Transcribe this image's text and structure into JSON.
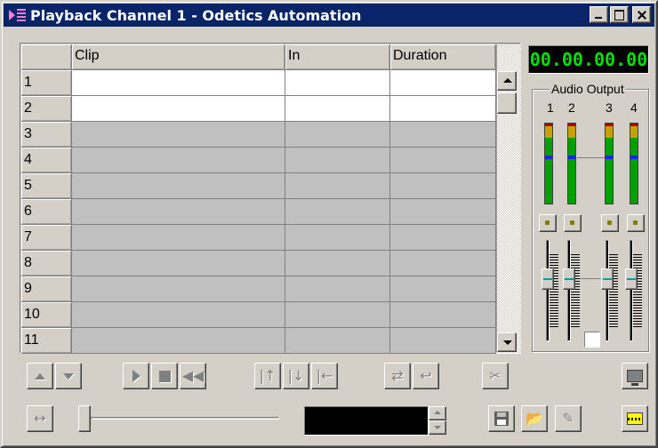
{
  "window": {
    "title": "Playback Channel 1 - Odetics Automation",
    "buttons": {
      "minimize": "minimize",
      "maximize": "maximize",
      "close": "close"
    }
  },
  "grid": {
    "columns": [
      "",
      "Clip",
      "In",
      "Duration"
    ],
    "rows": [
      {
        "num": "1",
        "clip": "",
        "in": "",
        "duration": "",
        "state": "white"
      },
      {
        "num": "2",
        "clip": "",
        "in": "",
        "duration": "",
        "state": "white"
      },
      {
        "num": "3",
        "clip": "",
        "in": "",
        "duration": "",
        "state": "grey"
      },
      {
        "num": "4",
        "clip": "",
        "in": "",
        "duration": "",
        "state": "grey"
      },
      {
        "num": "5",
        "clip": "",
        "in": "",
        "duration": "",
        "state": "grey"
      },
      {
        "num": "6",
        "clip": "",
        "in": "",
        "duration": "",
        "state": "grey"
      },
      {
        "num": "7",
        "clip": "",
        "in": "",
        "duration": "",
        "state": "grey"
      },
      {
        "num": "8",
        "clip": "",
        "in": "",
        "duration": "",
        "state": "grey"
      },
      {
        "num": "9",
        "clip": "",
        "in": "",
        "duration": "",
        "state": "grey"
      },
      {
        "num": "10",
        "clip": "",
        "in": "",
        "duration": "",
        "state": "grey"
      },
      {
        "num": "11",
        "clip": "",
        "in": "",
        "duration": "",
        "state": "grey"
      }
    ]
  },
  "timecode": "00.00.00.00",
  "audio": {
    "title": "Audio Output",
    "channels": [
      "1",
      "2",
      "3",
      "4"
    ],
    "colors": {
      "peak": "#b00000",
      "warn": "#c8a000",
      "level": "#00a000",
      "marker": "#2020ff"
    }
  },
  "toolbar": {
    "icons": {
      "cue_up": "arrow-up-icon",
      "cue_down": "arrow-down-icon",
      "play": "play-icon",
      "stop": "stop-icon",
      "rewind": "rewind-icon",
      "insert_before": "insert-above-icon",
      "insert_after": "insert-below-icon",
      "to_start": "to-start-icon",
      "loop": "loop-icon",
      "return": "return-icon",
      "cut": "scissors-icon",
      "monitor": "monitor-icon",
      "expand": "expand-horizontal-icon",
      "save": "save-icon",
      "open": "open-folder-icon",
      "edit": "edit-icon",
      "clipboard": "clip-list-icon"
    },
    "accent": "#0a246a"
  }
}
